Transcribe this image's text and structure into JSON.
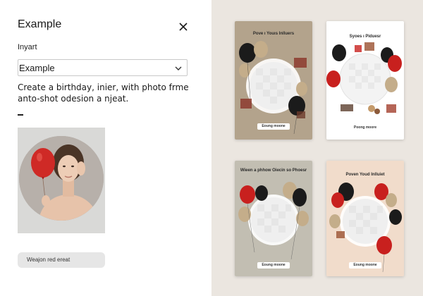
{
  "panel": {
    "title": "Example",
    "field_label": "Inyart",
    "select_value": "Example",
    "prompt_text": "Create a birthday, inier, with photo frme anto-shot odesion a njeat.",
    "bottom_button_label": "Weajon red ereat"
  },
  "gallery": {
    "cards": [
      {
        "heading": "Pove ı Youıs Inlluers",
        "button": "Eoung moone",
        "background": "#b3a38c"
      },
      {
        "heading": "Syoes ı Piduesr",
        "button": "Poong moore",
        "background": "#ffffff"
      },
      {
        "heading": "Wieen a phhow Oiecin so Phoesr",
        "button": "Eoung moone",
        "background": "#c2beb2"
      },
      {
        "heading": "Poven Youd Inlluiet",
        "button": "Eoung moone",
        "background": "#f1dccb"
      }
    ]
  },
  "colors": {
    "balloon_red": "#c8201e",
    "balloon_black": "#1b1b1b",
    "balloon_gold": "#c4ad8a"
  }
}
